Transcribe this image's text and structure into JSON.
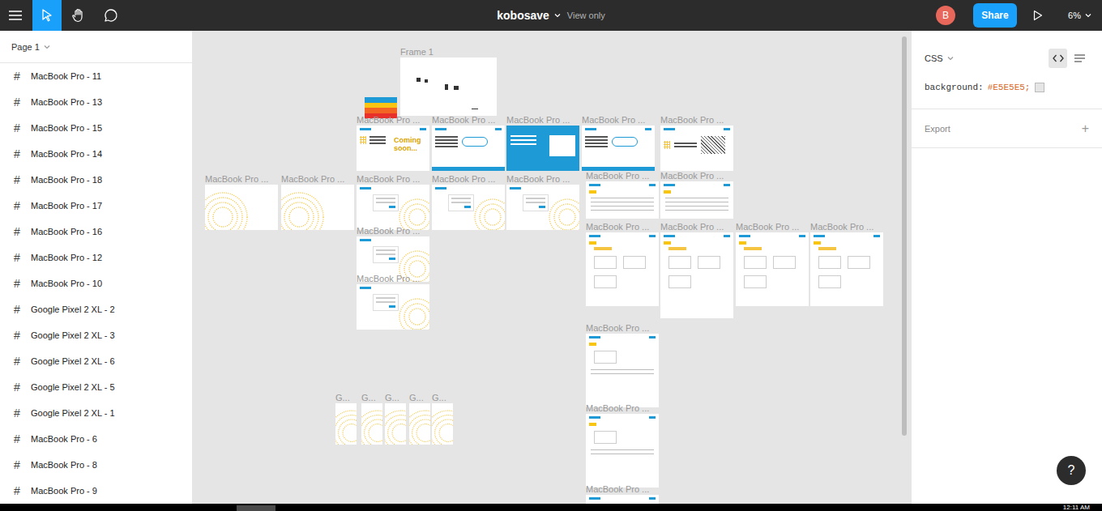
{
  "topbar": {
    "title": "kobosave",
    "mode": "View only",
    "avatar": "B",
    "share": "Share",
    "zoom": "6%",
    "tools": [
      {
        "kind": "move",
        "selected": true
      },
      {
        "kind": "hand",
        "selected": false
      },
      {
        "kind": "comment",
        "selected": false
      }
    ]
  },
  "sidebar": {
    "page": "Page 1",
    "layer_icon": "#",
    "layers": [
      "MacBook Pro - 11",
      "MacBook Pro - 13",
      "MacBook Pro - 15",
      "MacBook Pro - 14",
      "MacBook Pro - 18",
      "MacBook Pro - 17",
      "MacBook Pro - 16",
      "MacBook Pro - 12",
      "MacBook Pro - 10",
      "Google Pixel 2 XL - 2",
      "Google Pixel 2 XL - 3",
      "Google Pixel 2 XL - 6",
      "Google Pixel 2 XL - 5",
      "Google Pixel 2 XL - 1",
      "MacBook Pro - 6",
      "MacBook Pro - 8",
      "MacBook Pro - 9"
    ]
  },
  "canvas": {
    "frames": [
      {
        "label": "Frame 1",
        "kind": "sketch"
      },
      {
        "label": "MacBook Pro ...",
        "kind": "hero",
        "caption": "Coming soon..."
      },
      {
        "label": "MacBook Pro ...",
        "kind": "landing"
      },
      {
        "label": "MacBook Pro ...",
        "kind": "banner"
      },
      {
        "label": "MacBook Pro ...",
        "kind": "landing"
      },
      {
        "label": "MacBook Pro ...",
        "kind": "illustration"
      },
      {
        "label": "MacBook Pro ...",
        "kind": "rings"
      },
      {
        "label": "MacBook Pro ...",
        "kind": "rings"
      },
      {
        "label": "MacBook Pro ...",
        "kind": "form"
      },
      {
        "label": "MacBook Pro ...",
        "kind": "form"
      },
      {
        "label": "MacBook Pro ...",
        "kind": "form"
      },
      {
        "label": "MacBook Pro ...",
        "kind": "table"
      },
      {
        "label": "MacBook Pro ...",
        "kind": "table"
      },
      {
        "label": "MacBook Pro ...",
        "kind": "form"
      },
      {
        "label": "MacBook Pro ...",
        "kind": "form"
      },
      {
        "label": "MacBook Pro ...",
        "kind": "dashboard"
      },
      {
        "label": "MacBook Pro ...",
        "kind": "dashboard"
      },
      {
        "label": "MacBook Pro ...",
        "kind": "dashboard"
      },
      {
        "label": "MacBook Pro ...",
        "kind": "dashboard"
      },
      {
        "label": "MacBook Pro ...",
        "kind": "panel"
      },
      {
        "label": "MacBook Pro ...",
        "kind": "panel"
      },
      {
        "label": "MacBook Pro ...",
        "kind": "panel"
      },
      {
        "label": "G...",
        "kind": "phone"
      },
      {
        "label": "G...",
        "kind": "phone"
      },
      {
        "label": "G...",
        "kind": "phone"
      },
      {
        "label": "G...",
        "kind": "phone"
      },
      {
        "label": "G...",
        "kind": "phone"
      }
    ]
  },
  "inspector": {
    "language": "CSS",
    "views": [
      {
        "kind": "code",
        "selected": true
      },
      {
        "kind": "list",
        "selected": false
      }
    ],
    "properties": [
      {
        "name": "background:",
        "value": "#E5E5E5;",
        "swatch": "#E5E5E5"
      }
    ],
    "export": {
      "label": "Export",
      "add": "+"
    }
  },
  "taskbar": {
    "time": "12:11 AM"
  },
  "help": "?"
}
